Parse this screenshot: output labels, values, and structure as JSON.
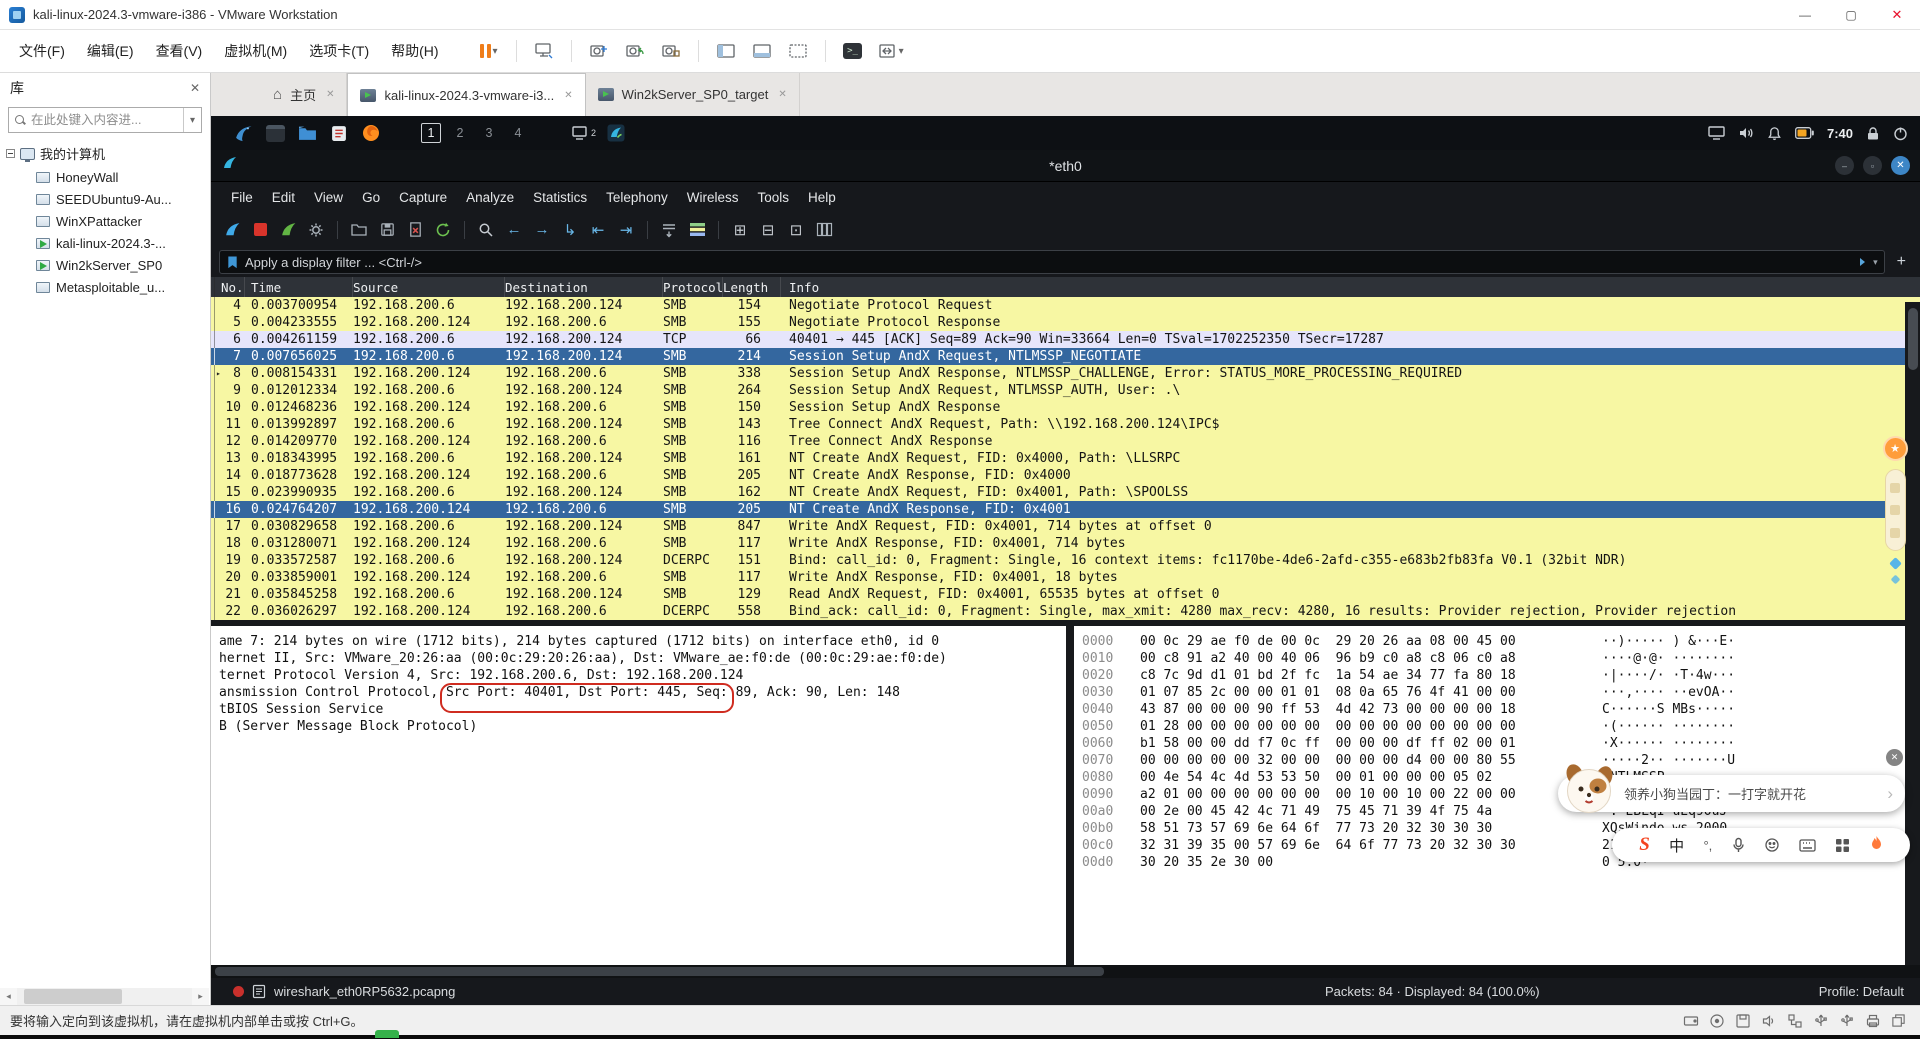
{
  "icons": {
    "min": "—",
    "max": "▢",
    "close": "✕",
    "home": "⌂",
    "caret": "▾",
    "tab_close": "✕",
    "left_arrow": "◂",
    "right_arrow": "▸",
    "back": "←",
    "forward": "→",
    "jump": "↳",
    "first": "⇤",
    "last": "⇥",
    "zoom_in": "⊞",
    "zoom_out": "⊟",
    "zoom_reset": "⊡",
    "ws_min": "–",
    "ws_max": "▫",
    "ws_close": "✕",
    "plus": "+",
    "chevron": "›",
    "console": "&gt;_"
  },
  "vmware": {
    "title": "kali-linux-2024.3-vmware-i386 - VMware Workstation",
    "menus": [
      "文件(F)",
      "编辑(E)",
      "查看(V)",
      "虚拟机(M)",
      "选项卡(T)",
      "帮助(H)"
    ],
    "tabs": {
      "home": "主页",
      "kali": "kali-linux-2024.3-vmware-i3...",
      "win2k": "Win2kServer_SP0_target"
    },
    "status_hint": "要将输入定向到该虚拟机，请在虚拟机内部单击或按 Ctrl+G。"
  },
  "library": {
    "title": "库",
    "search_placeholder": "在此处键入内容进...",
    "root": "我的计算机",
    "items": [
      {
        "label": "HoneyWall",
        "state": "stopped"
      },
      {
        "label": "SEEDUbuntu9-Au...",
        "state": "stopped"
      },
      {
        "label": "WinXPattacker",
        "state": "stopped"
      },
      {
        "label": "kali-linux-2024.3-...",
        "state": "running"
      },
      {
        "label": "Win2kServer_SP0",
        "state": "running"
      },
      {
        "label": "Metasploitable_u...",
        "state": "stopped"
      }
    ]
  },
  "kali": {
    "workspaces": [
      {
        "n": "1",
        "cls": "active"
      },
      {
        "n": "2"
      },
      {
        "n": "3"
      },
      {
        "n": "4"
      }
    ],
    "badge2": "2",
    "clock": "7:40"
  },
  "wireshark": {
    "window_title": "*eth0",
    "menus": [
      "File",
      "Edit",
      "View",
      "Go",
      "Capture",
      "Analyze",
      "Statistics",
      "Telephony",
      "Wireless",
      "Tools",
      "Help"
    ],
    "filter_placeholder": "Apply a display filter ... <Ctrl-/>",
    "columns": [
      "No.",
      "Time",
      "Source",
      "Destination",
      "Protocol",
      "Length",
      "Info"
    ],
    "packets": [
      {
        "no": "4",
        "time": "0.003700954",
        "src": "192.168.200.6",
        "dst": "192.168.200.124",
        "proto": "SMB",
        "len": "154",
        "info": "Negotiate Protocol Request",
        "cls": "smb"
      },
      {
        "no": "5",
        "time": "0.004233555",
        "src": "192.168.200.124",
        "dst": "192.168.200.6",
        "proto": "SMB",
        "len": "155",
        "info": "Negotiate Protocol Response",
        "cls": "smb"
      },
      {
        "no": "6",
        "time": "0.004261159",
        "src": "192.168.200.6",
        "dst": "192.168.200.124",
        "proto": "TCP",
        "len": "66",
        "info": "40401 → 445 [ACK] Seq=89 Ack=90 Win=33664 Len=0 TSval=1702252350 TSecr=17287",
        "cls": "tcp"
      },
      {
        "no": "7",
        "time": "0.007656025",
        "src": "192.168.200.6",
        "dst": "192.168.200.124",
        "proto": "SMB",
        "len": "214",
        "info": "Session Setup AndX Request, NTLMSSP_NEGOTIATE",
        "cls": "sel"
      },
      {
        "no": "8",
        "time": "0.008154331",
        "src": "192.168.200.124",
        "dst": "192.168.200.6",
        "proto": "SMB",
        "len": "338",
        "info": "Session Setup AndX Response, NTLMSSP_CHALLENGE, Error: STATUS_MORE_PROCESSING_REQUIRED",
        "cls": "smb",
        "mark": "▸"
      },
      {
        "no": "9",
        "time": "0.012012334",
        "src": "192.168.200.6",
        "dst": "192.168.200.124",
        "proto": "SMB",
        "len": "264",
        "info": "Session Setup AndX Request, NTLMSSP_AUTH, User: .\\",
        "cls": "smb"
      },
      {
        "no": "10",
        "time": "0.012468236",
        "src": "192.168.200.124",
        "dst": "192.168.200.6",
        "proto": "SMB",
        "len": "150",
        "info": "Session Setup AndX Response",
        "cls": "smb"
      },
      {
        "no": "11",
        "time": "0.013992897",
        "src": "192.168.200.6",
        "dst": "192.168.200.124",
        "proto": "SMB",
        "len": "143",
        "info": "Tree Connect AndX Request, Path: \\\\192.168.200.124\\IPC$",
        "cls": "smb"
      },
      {
        "no": "12",
        "time": "0.014209770",
        "src": "192.168.200.124",
        "dst": "192.168.200.6",
        "proto": "SMB",
        "len": "116",
        "info": "Tree Connect AndX Response",
        "cls": "smb"
      },
      {
        "no": "13",
        "time": "0.018343995",
        "src": "192.168.200.6",
        "dst": "192.168.200.124",
        "proto": "SMB",
        "len": "161",
        "info": "NT Create AndX Request, FID: 0x4000, Path: \\LLSRPC",
        "cls": "smb"
      },
      {
        "no": "14",
        "time": "0.018773628",
        "src": "192.168.200.124",
        "dst": "192.168.200.6",
        "proto": "SMB",
        "len": "205",
        "info": "NT Create AndX Response, FID: 0x4000",
        "cls": "smb"
      },
      {
        "no": "15",
        "time": "0.023990935",
        "src": "192.168.200.6",
        "dst": "192.168.200.124",
        "proto": "SMB",
        "len": "162",
        "info": "NT Create AndX Request, FID: 0x4001, Path: \\SPOOLSS",
        "cls": "smb"
      },
      {
        "no": "16",
        "time": "0.024764207",
        "src": "192.168.200.124",
        "dst": "192.168.200.6",
        "proto": "SMB",
        "len": "205",
        "info": "NT Create AndX Response, FID: 0x4001",
        "cls": "sel"
      },
      {
        "no": "17",
        "time": "0.030829658",
        "src": "192.168.200.6",
        "dst": "192.168.200.124",
        "proto": "SMB",
        "len": "847",
        "info": "Write AndX Request, FID: 0x4001, 714 bytes at offset 0",
        "cls": "smb"
      },
      {
        "no": "18",
        "time": "0.031280071",
        "src": "192.168.200.124",
        "dst": "192.168.200.6",
        "proto": "SMB",
        "len": "117",
        "info": "Write AndX Response, FID: 0x4001, 714 bytes",
        "cls": "smb"
      },
      {
        "no": "19",
        "time": "0.033572587",
        "src": "192.168.200.6",
        "dst": "192.168.200.124",
        "proto": "DCERPC",
        "len": "151",
        "info": "Bind: call_id: 0, Fragment: Single, 16 context items: fc1170be-4de6-2afd-c355-e683b2fb83fa V0.1 (32bit NDR)",
        "cls": "smb"
      },
      {
        "no": "20",
        "time": "0.033859001",
        "src": "192.168.200.124",
        "dst": "192.168.200.6",
        "proto": "SMB",
        "len": "117",
        "info": "Write AndX Response, FID: 0x4001, 18 bytes",
        "cls": "smb"
      },
      {
        "no": "21",
        "time": "0.035845258",
        "src": "192.168.200.6",
        "dst": "192.168.200.124",
        "proto": "SMB",
        "len": "129",
        "info": "Read AndX Request, FID: 0x4001, 65535 bytes at offset 0",
        "cls": "smb"
      },
      {
        "no": "22",
        "time": "0.036026297",
        "src": "192.168.200.124",
        "dst": "192.168.200.6",
        "proto": "DCERPC",
        "len": "558",
        "info": "Bind_ack: call_id: 0, Fragment: Single, max_xmit: 4280 max_recv: 4280, 16 results: Provider rejection, Provider rejection",
        "cls": "smb"
      }
    ],
    "details": {
      "l1": "ame 7: 214 bytes on wire (1712 bits), 214 bytes captured (1712 bits) on interface eth0, id 0",
      "l2": "hernet II, Src: VMware_20:26:aa (00:0c:29:20:26:aa), Dst: VMware_ae:f0:de (00:0c:29:ae:f0:de)",
      "l3": "ternet Protocol Version 4, Src: 192.168.200.6, Dst: 192.168.200.124",
      "l4a": "ansmission Control Protocol, ",
      "l4b": "Src Port: 40401, Dst Port: 445, Seq",
      "l4c": ": 89, Ack: 90, Len: 148",
      "l5": "tBIOS Session Service",
      "l6": "B (Server Message Block Protocol)"
    },
    "hex_rows": [
      {
        "off": "0000",
        "hex": "00 0c 29 ae f0 de 00 0c  29 20 26 aa 08 00 45 00",
        "ascii": "··)····· ) &···E·"
      },
      {
        "off": "0010",
        "hex": "00 c8 91 a2 40 00 40 06  96 b9 c0 a8 c8 06 c0 a8",
        "ascii": "····@·@· ········"
      },
      {
        "off": "0020",
        "hex": "c8 7c 9d d1 01 bd 2f fc  1a 54 ae 34 77 fa 80 18",
        "ascii": "·|····/· ·T·4w···"
      },
      {
        "off": "0030",
        "hex": "01 07 85 2c 00 00 01 01  08 0a 65 76 4f 41 00 00",
        "ascii": "···,···· ··evOA··"
      },
      {
        "off": "0040",
        "hex": "43 87 00 00 00 90 ff 53  4d 42 73 00 00 00 00 18",
        "ascii": "C······S MBs·····"
      },
      {
        "off": "0050",
        "hex": "01 28 00 00 00 00 00 00  00 00 00 00 00 00 00 00",
        "ascii": "·(······ ········"
      },
      {
        "off": "0060",
        "hex": "b1 58 00 00 dd f7 0c ff  00 00 00 df ff 02 00 01",
        "ascii": "·X······ ········"
      },
      {
        "off": "0070",
        "hex": "00 00 00 00 00 32 00 00  00 00 00 d4 00 00 80 55",
        "ascii": "·····2·· ·······U"
      },
      {
        "off": "0080",
        "hex": "00 4e 54 4c 4d 53 53 50  00 01 00 00 00 05 02",
        "ascii": "·NTLMSSP ·····"
      },
      {
        "off": "0090",
        "hex": "a2 01 00 00 00 00 00 00  00 10 00 10 00 22 00 00",
        "ascii": "········ ·····\"··"
      },
      {
        "off": "00a0",
        "hex": "00 2e 00 45 42 4c 71 49  75 45 71 39 4f 75 4a",
        "ascii": "·.·EBLqI uEq9OuJ"
      },
      {
        "off": "00b0",
        "hex": "58 51 73 57 69 6e 64 6f  77 73 20 32 30 30 30",
        "ascii": "XQsWindo ws 2000"
      },
      {
        "off": "00c0",
        "hex": "32 31 39 35 00 57 69 6e  64 6f 77 73 20 32 30 30",
        "ascii": "2195·Win dows 200"
      },
      {
        "off": "00d0",
        "hex": "30 20 35 2e 30 00",
        "ascii": "0 5.0·"
      }
    ],
    "status": {
      "filename": "wireshark_eth0RP5632.pcapng",
      "packets": "Packets: 84 · Displayed: 84 (100.0%)",
      "profile": "Profile: Default"
    }
  },
  "ime": {
    "ad_text": "领养小狗当园丁：一打字就开花",
    "logo": "S",
    "lang": "中",
    "punct": "°,"
  }
}
